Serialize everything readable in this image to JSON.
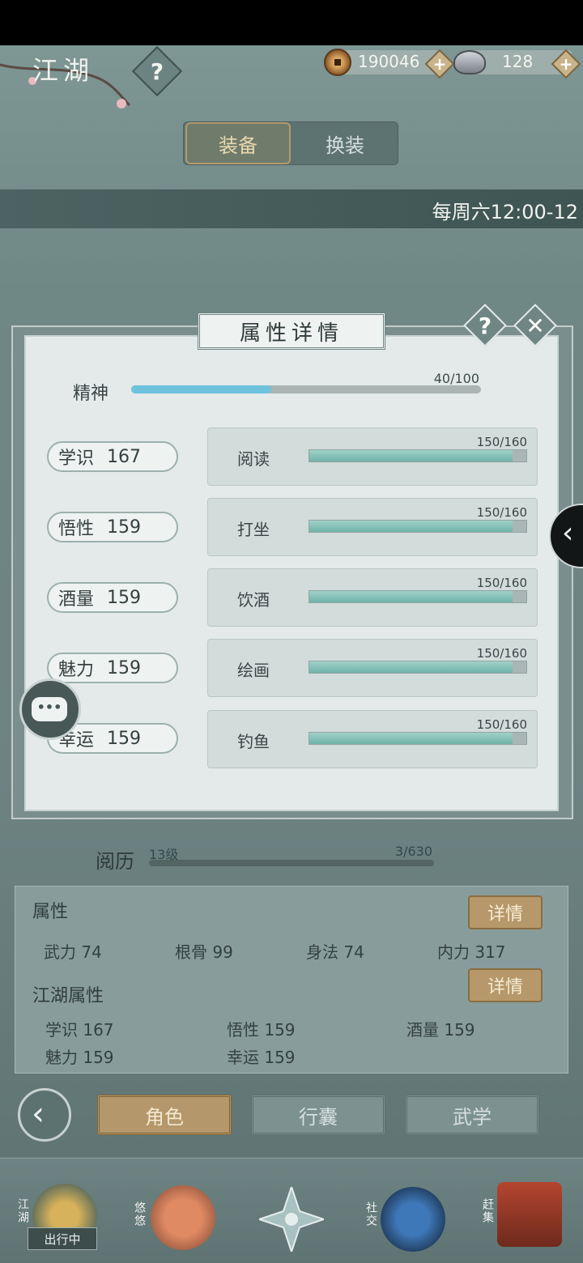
{
  "header": {
    "title": "江湖",
    "help_label": "?",
    "copper_amount": "190046",
    "silver_amount": "128",
    "plus_label": "+"
  },
  "tabs": {
    "equip_label": "装备",
    "outfit_label": "换装"
  },
  "banner": {
    "text": "每周六12:00-12"
  },
  "modal": {
    "title": "属性详情",
    "help_label": "?",
    "close_label": "✕",
    "spirit": {
      "label": "精神",
      "value_text": "40/100",
      "fraction": 0.4
    },
    "rows": [
      {
        "attr": "学识",
        "attr_value": "167",
        "skill": "阅读",
        "skill_value": "150/160",
        "fraction": 0.9375
      },
      {
        "attr": "悟性",
        "attr_value": "159",
        "skill": "打坐",
        "skill_value": "150/160",
        "fraction": 0.9375
      },
      {
        "attr": "酒量",
        "attr_value": "159",
        "skill": "饮酒",
        "skill_value": "150/160",
        "fraction": 0.9375
      },
      {
        "attr": "魅力",
        "attr_value": "159",
        "skill": "绘画",
        "skill_value": "150/160",
        "fraction": 0.9375
      },
      {
        "attr": "幸运",
        "attr_value": "159",
        "skill": "钓鱼",
        "skill_value": "150/160",
        "fraction": 0.9375
      }
    ]
  },
  "experience": {
    "label": "阅历",
    "level": "13级",
    "value_text": "3/630"
  },
  "attributes": {
    "title": "属性",
    "detail_label": "详情",
    "items": [
      "武力 74",
      "根骨 99",
      "身法 74",
      "内力 317"
    ]
  },
  "jianghu_attributes": {
    "title": "江湖属性",
    "detail_label": "详情",
    "items": [
      "学识 167",
      "悟性 159",
      "酒量 159",
      "魅力 159",
      "幸运 159"
    ]
  },
  "bottom_tabs": {
    "role": "角色",
    "bag": "行囊",
    "martial": "武学"
  },
  "nav": {
    "jianghu": "江湖",
    "badge": "出行中",
    "leisure": "悠悠",
    "social": "社交",
    "market": "赶集"
  },
  "colors": {
    "accent_gold": "#b6986a",
    "spirit_bar": "#6ec2de",
    "skill_bar": "#6fb3a9"
  }
}
